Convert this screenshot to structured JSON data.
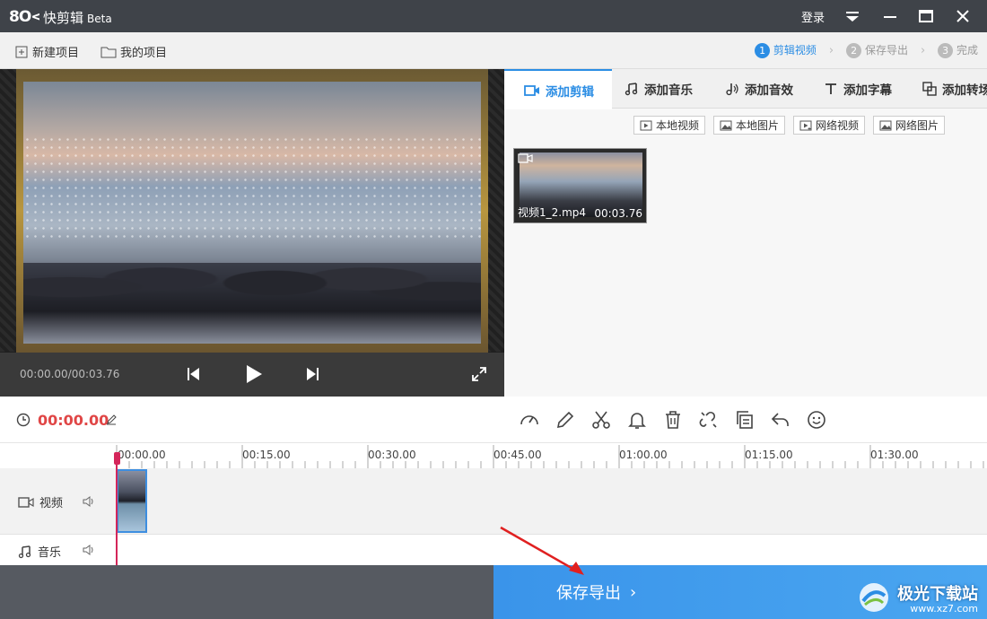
{
  "app": {
    "logo": "KK",
    "title": "快剪辑",
    "beta": "Beta",
    "login": "登录"
  },
  "toolbar": {
    "new_project": "新建项目",
    "my_projects": "我的项目",
    "steps": [
      {
        "num": "1",
        "label": "剪辑视频",
        "active": true
      },
      {
        "num": "2",
        "label": "保存导出",
        "active": false
      },
      {
        "num": "3",
        "label": "完成",
        "active": false
      }
    ]
  },
  "player": {
    "time": "00:00.00/00:03.76"
  },
  "tabs": [
    "添加剪辑",
    "添加音乐",
    "添加音效",
    "添加字幕",
    "添加转场"
  ],
  "sources": [
    "本地视频",
    "本地图片",
    "网络视频",
    "网络图片"
  ],
  "media": {
    "name": "视频1_2.mp4",
    "duration": "00:03.76"
  },
  "edit": {
    "current_time": "00:00.00"
  },
  "ruler": [
    "00:00.00",
    "00:15.00",
    "00:30.00",
    "00:45.00",
    "01:00.00",
    "01:15.00",
    "01:30.00"
  ],
  "tracks": {
    "video": "视频",
    "music": "音乐"
  },
  "export": {
    "label": "保存导出"
  },
  "watermark": {
    "text": "极光下载站",
    "sub": "www.xz7.com"
  },
  "colors": {
    "accent": "#2b8de4",
    "time_red": "#e04646",
    "playhead": "#d4265a"
  }
}
